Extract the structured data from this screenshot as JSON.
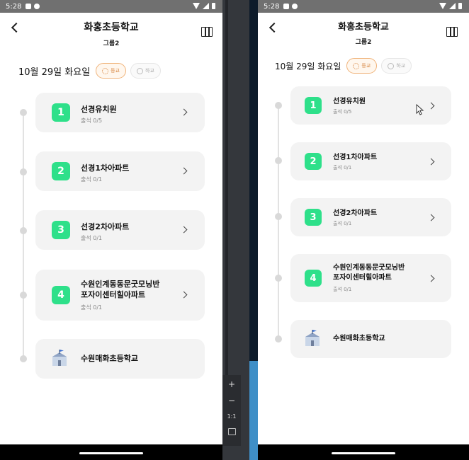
{
  "status": {
    "time": "5:28"
  },
  "header": {
    "title": "화홍초등학교",
    "subtitle": "그룹2"
  },
  "date_row": {
    "date": "10월 29일 화요일",
    "chip_active": "등교",
    "chip_inactive": "하교"
  },
  "stops": [
    {
      "number": "1",
      "name": "선경유치원",
      "attendance": "출석 0/5"
    },
    {
      "number": "2",
      "name": "선경1차아파트",
      "attendance": "출석 0/1"
    },
    {
      "number": "3",
      "name": "선경2차아파트",
      "attendance": "출석 0/1"
    },
    {
      "number": "4",
      "name_line1": "수원인계동동문굿모닝반",
      "name_line2": "포자이센터힐아파트",
      "attendance": "출석 0/1"
    }
  ],
  "destination": {
    "name": "수원매화초등학교"
  },
  "zoom_controls": {
    "plus": "+",
    "minus": "−",
    "ratio": "1:1"
  },
  "colors": {
    "badge": "#2ee08a",
    "chip_active_border": "#f0b37a",
    "card_bg": "#f3f3f3"
  }
}
